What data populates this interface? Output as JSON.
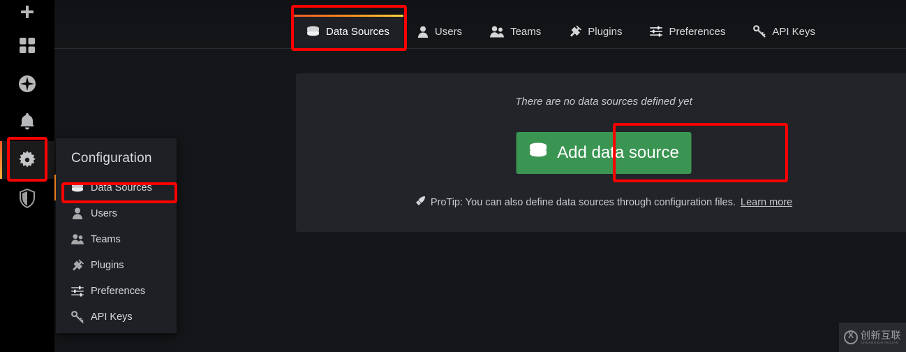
{
  "rail": {
    "items": [
      {
        "name": "create-add",
        "icon": "plus-icon",
        "label": "Create"
      },
      {
        "name": "dashboards",
        "icon": "dashboards-icon",
        "label": "Dashboards"
      },
      {
        "name": "explore",
        "icon": "compass-icon",
        "label": "Explore"
      },
      {
        "name": "alerting",
        "icon": "bell-icon",
        "label": "Alerting"
      },
      {
        "name": "configuration",
        "icon": "gear-icon",
        "label": "Configuration"
      },
      {
        "name": "server-admin",
        "icon": "shield-icon",
        "label": "Server Admin"
      }
    ]
  },
  "dropdown": {
    "title": "Configuration",
    "items": [
      {
        "label": "Data Sources",
        "icon": "database-icon",
        "current": true
      },
      {
        "label": "Users",
        "icon": "user-icon",
        "current": false
      },
      {
        "label": "Teams",
        "icon": "users-icon",
        "current": false
      },
      {
        "label": "Plugins",
        "icon": "plug-icon",
        "current": false
      },
      {
        "label": "Preferences",
        "icon": "sliders-icon",
        "current": false
      },
      {
        "label": "API Keys",
        "icon": "key-icon",
        "current": false
      }
    ]
  },
  "tabs": [
    {
      "label": "Data Sources",
      "icon": "database-icon",
      "active": true
    },
    {
      "label": "Users",
      "icon": "user-icon",
      "active": false
    },
    {
      "label": "Teams",
      "icon": "users-icon",
      "active": false
    },
    {
      "label": "Plugins",
      "icon": "plug-icon",
      "active": false
    },
    {
      "label": "Preferences",
      "icon": "sliders-icon",
      "active": false
    },
    {
      "label": "API Keys",
      "icon": "key-icon",
      "active": false
    }
  ],
  "panel": {
    "empty_message": "There are no data sources defined yet",
    "add_button_label": "Add data source",
    "protip_prefix": "ProTip: You can also define data sources through configuration files.",
    "protip_link": "Learn more"
  },
  "colors": {
    "accent_orange": "#eb7b18",
    "tab_gradient_start": "#f05a28",
    "tab_gradient_end": "#fbd33b",
    "button_green": "#3a9552",
    "annotation_red": "#ff0000",
    "panel_bg": "#22242a",
    "page_bg": "#141619",
    "rail_bg": "#000000"
  },
  "watermark": {
    "cn_text": "创新互联",
    "en_text": "CHUANGXIN HULIAN"
  }
}
